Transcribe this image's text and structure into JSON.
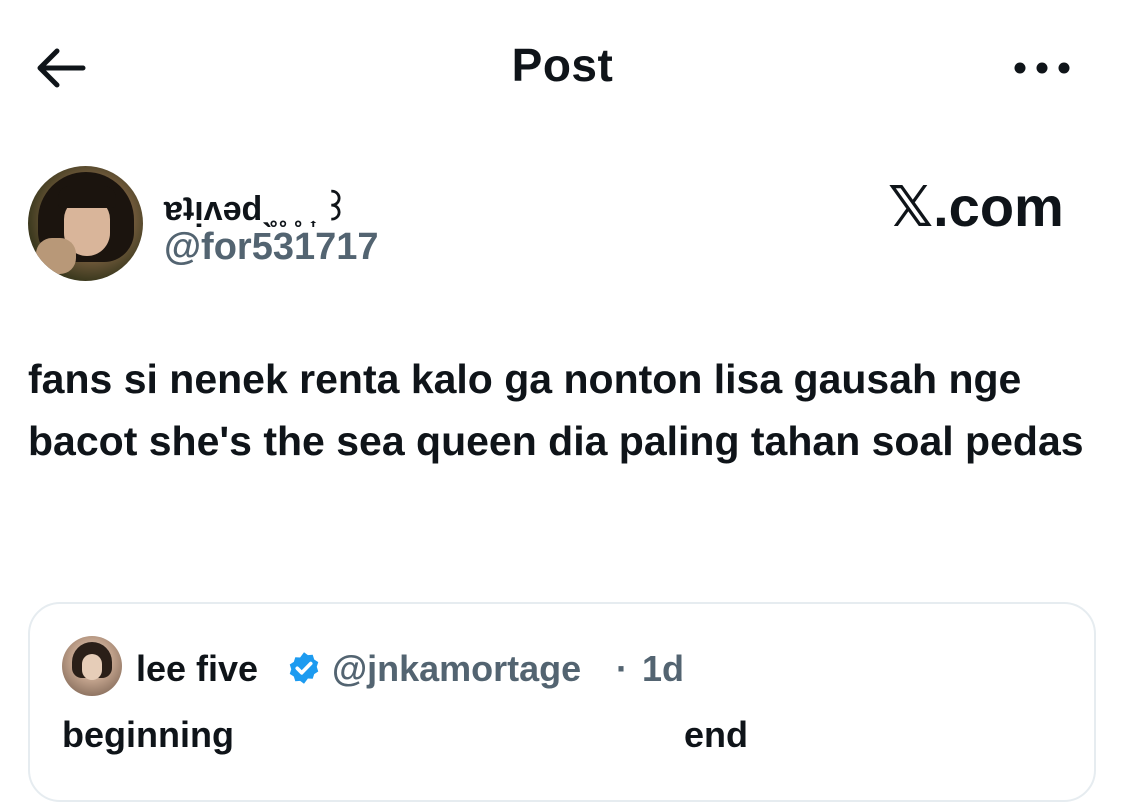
{
  "header": {
    "title": "Post",
    "back_icon": "arrow-left-icon",
    "more_icon": "more-horizontal-icon"
  },
  "author": {
    "display_name": "ɐʇᴉʌǝdˎ̥ ̥ ˳ ͎ ꒱",
    "handle": "@for531717"
  },
  "watermark": "𝕏.com",
  "post": {
    "text": "fans si nenek renta kalo ga nonton lisa gausah nge bacot she's the sea queen dia paling tahan soal pedas"
  },
  "quote": {
    "name": "lee five",
    "handle": "@jnkamortage",
    "separator": "·",
    "time": "1d",
    "text_left": "beginning",
    "text_right": "end",
    "verified_color": "#1d9bf0"
  },
  "colors": {
    "text_primary": "#0f1419",
    "text_secondary": "#536471",
    "border": "#e6ecf0"
  }
}
